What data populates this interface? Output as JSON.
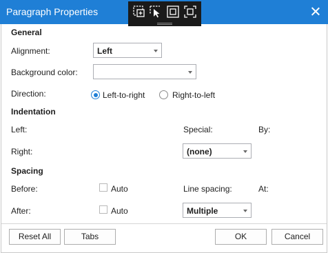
{
  "window": {
    "title": "Paragraph Properties"
  },
  "capture_toolbar": {
    "icons": [
      "add-region-icon",
      "cursor-select-icon",
      "window-capture-icon",
      "fullscreen-capture-icon"
    ]
  },
  "general": {
    "heading": "General",
    "alignment_label": "Alignment:",
    "alignment_value": "Left",
    "background_label": "Background color:",
    "background_value": "",
    "direction_label": "Direction:",
    "direction_options": [
      "Left-to-right",
      "Right-to-left"
    ],
    "direction_selected": "Left-to-right"
  },
  "indentation": {
    "heading": "Indentation",
    "left_label": "Left:",
    "right_label": "Right:",
    "special_label": "Special:",
    "by_label": "By:",
    "special_value": "(none)"
  },
  "spacing": {
    "heading": "Spacing",
    "before_label": "Before:",
    "after_label": "After:",
    "auto_label": "Auto",
    "before_auto_checked": false,
    "after_auto_checked": false,
    "line_spacing_label": "Line spacing:",
    "at_label": "At:",
    "line_spacing_value": "Multiple"
  },
  "footer": {
    "reset_all": "Reset All",
    "tabs": "Tabs",
    "ok": "OK",
    "cancel": "Cancel"
  },
  "colors": {
    "titlebar": "#1f7fd6",
    "capture_toolbar": "#1a1a1a",
    "radio_accent": "#1f7fd6"
  }
}
